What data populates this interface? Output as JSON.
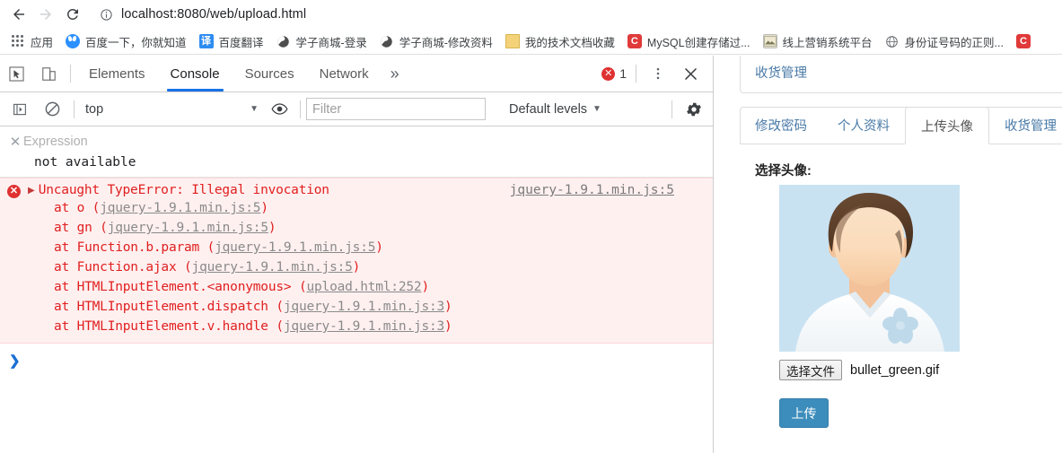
{
  "browser": {
    "nav": {
      "back_label": "Back",
      "forward_label": "Forward",
      "reload_label": "Reload"
    },
    "omnibox": {
      "url": "localhost:8080/web/upload.html",
      "info_icon": "info-circle-icon"
    },
    "bookmarks": [
      {
        "label": "应用",
        "icon": "apps-grid-icon"
      },
      {
        "label": "百度一下，你就知道",
        "icon": "baidu-paw-icon"
      },
      {
        "label": "百度翻译",
        "icon": "baidu-fanyi-icon"
      },
      {
        "label": "学子商城-登录",
        "icon": "globe-icon"
      },
      {
        "label": "学子商城-修改资料",
        "icon": "globe-icon"
      },
      {
        "label": "我的技术文档收藏",
        "icon": "folder-icon"
      },
      {
        "label": "MySQL创建存储过...",
        "icon": "csdn-icon"
      },
      {
        "label": "线上营销系统平台",
        "icon": "image-icon"
      },
      {
        "label": "身份证号码的正则...",
        "icon": "globe-outline-icon"
      },
      {
        "label": "",
        "icon": "csdn-icon"
      }
    ]
  },
  "devtools": {
    "toolbar": {
      "inspect_icon": "inspect-cursor-icon",
      "device_icon": "device-toolbar-icon",
      "tabs": [
        {
          "label": "Elements",
          "active": false
        },
        {
          "label": "Console",
          "active": true
        },
        {
          "label": "Sources",
          "active": false
        },
        {
          "label": "Network",
          "active": false
        }
      ],
      "more_tabs_label": "»",
      "error_count": "1",
      "error_badge_glyph": "✕",
      "menu_icon": "kebab-menu-icon",
      "close_icon": "close-icon"
    },
    "filterbar": {
      "sidebar_icon": "console-sidebar-icon",
      "clear_icon": "clear-console-icon",
      "context": "top",
      "context_caret": "▼",
      "eye_icon": "live-expression-eye-icon",
      "filter_placeholder": "Filter",
      "filter_value": "",
      "levels_label": "Default levels",
      "levels_caret": "▼",
      "settings_icon": "gear-icon"
    },
    "live_expression": {
      "close_glyph": "✕",
      "placeholder": "Expression",
      "value": "not available"
    },
    "error": {
      "badge_glyph": "✕",
      "expand_glyph": "▶",
      "message": "Uncaught TypeError: Illegal invocation",
      "source": "jquery-1.9.1.min.js:5",
      "stack": [
        {
          "prefix": "at o (",
          "link": "jquery-1.9.1.min.js:5",
          "suffix": ")"
        },
        {
          "prefix": "at gn (",
          "link": "jquery-1.9.1.min.js:5",
          "suffix": ")"
        },
        {
          "prefix": "at Function.b.param (",
          "link": "jquery-1.9.1.min.js:5",
          "suffix": ")"
        },
        {
          "prefix": "at Function.ajax (",
          "link": "jquery-1.9.1.min.js:5",
          "suffix": ")"
        },
        {
          "prefix": "at HTMLInputElement.<anonymous> (",
          "link": "upload.html:252",
          "suffix": ")"
        },
        {
          "prefix": "at HTMLInputElement.dispatch (",
          "link": "jquery-1.9.1.min.js:3",
          "suffix": ")"
        },
        {
          "prefix": "at HTMLInputElement.v.handle (",
          "link": "jquery-1.9.1.min.js:3",
          "suffix": ")"
        }
      ]
    },
    "prompt": {
      "chevron": "❯"
    }
  },
  "page": {
    "top_panel": {
      "link": "收货管理"
    },
    "tabs": [
      {
        "label": "修改密码",
        "active": false
      },
      {
        "label": "个人资料",
        "active": false
      },
      {
        "label": "上传头像",
        "active": true
      },
      {
        "label": "收货管理",
        "active": false
      }
    ],
    "form": {
      "label": "选择头像:",
      "avatar_alt": "default-user-avatar",
      "file_button": "选择文件",
      "file_name": "bullet_green.gif",
      "submit_button": "上传"
    }
  },
  "colors": {
    "accent_blue": "#1a73e8",
    "error_red": "#df3131",
    "error_bg": "#fff0f0",
    "link_blue": "#4a7aa7",
    "button_blue": "#3c8dbc",
    "avatar_bg": "#c9e2f2"
  }
}
